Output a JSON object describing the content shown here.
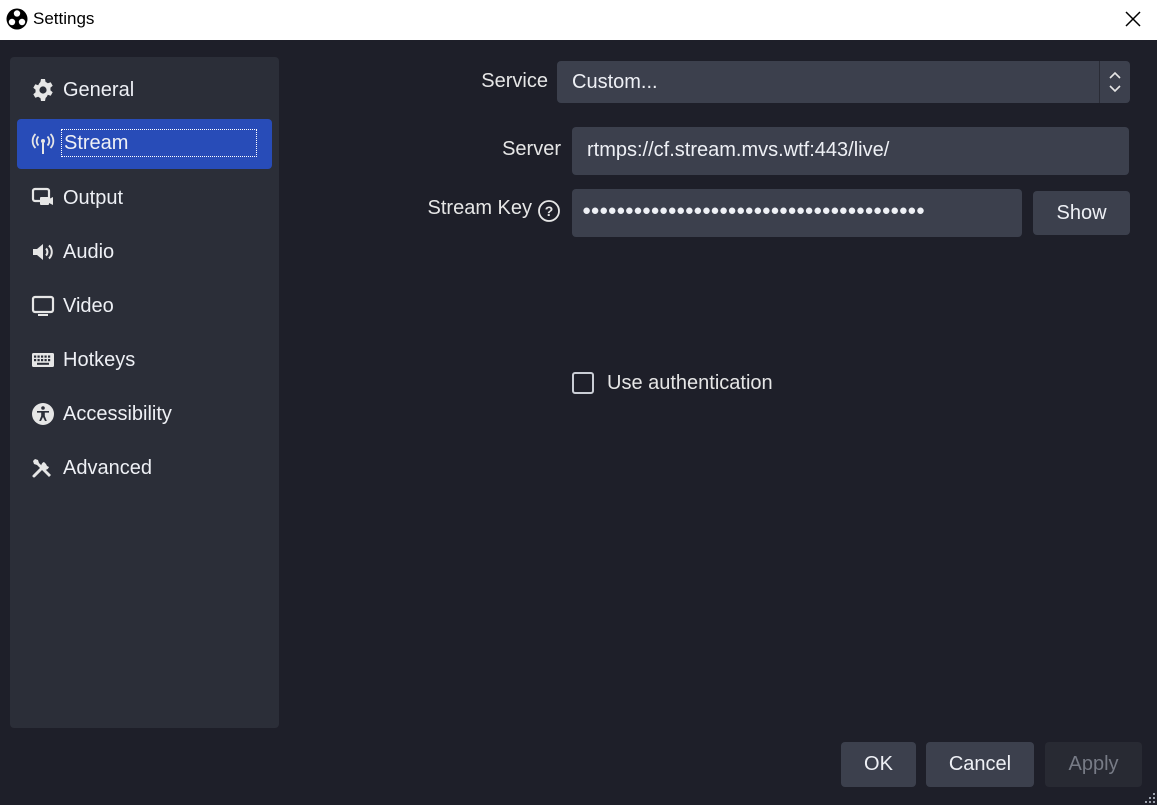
{
  "window": {
    "title": "Settings",
    "app_icon": "obs-logo-icon",
    "close_icon": "close-icon"
  },
  "sidebar": {
    "items": [
      {
        "label": "General",
        "icon": "gear-icon",
        "active": false
      },
      {
        "label": "Stream",
        "icon": "broadcast-antenna-icon",
        "active": true
      },
      {
        "label": "Output",
        "icon": "output-monitor-camera-icon",
        "active": false
      },
      {
        "label": "Audio",
        "icon": "speaker-icon",
        "active": false
      },
      {
        "label": "Video",
        "icon": "monitor-icon",
        "active": false
      },
      {
        "label": "Hotkeys",
        "icon": "keyboard-icon",
        "active": false
      },
      {
        "label": "Accessibility",
        "icon": "accessibility-icon",
        "active": false
      },
      {
        "label": "Advanced",
        "icon": "tools-icon",
        "active": false
      }
    ]
  },
  "stream": {
    "service_label": "Service",
    "service_value": "Custom...",
    "server_label": "Server",
    "server_value": "rtmps://cf.stream.mvs.wtf:443/live/",
    "stream_key_label": "Stream Key",
    "stream_key_masked": "●●●●●●●●●●●●●●●●●●●●●●●●●●●●●●●●●●●●●●●●",
    "show_button": "Show",
    "use_auth_label": "Use authentication",
    "use_auth_checked": false
  },
  "footer": {
    "ok": "OK",
    "cancel": "Cancel",
    "apply": "Apply"
  },
  "colors": {
    "background": "#1e1f29",
    "panel": "#2b2e38",
    "input": "#3c404d",
    "accent": "#284cb8"
  }
}
